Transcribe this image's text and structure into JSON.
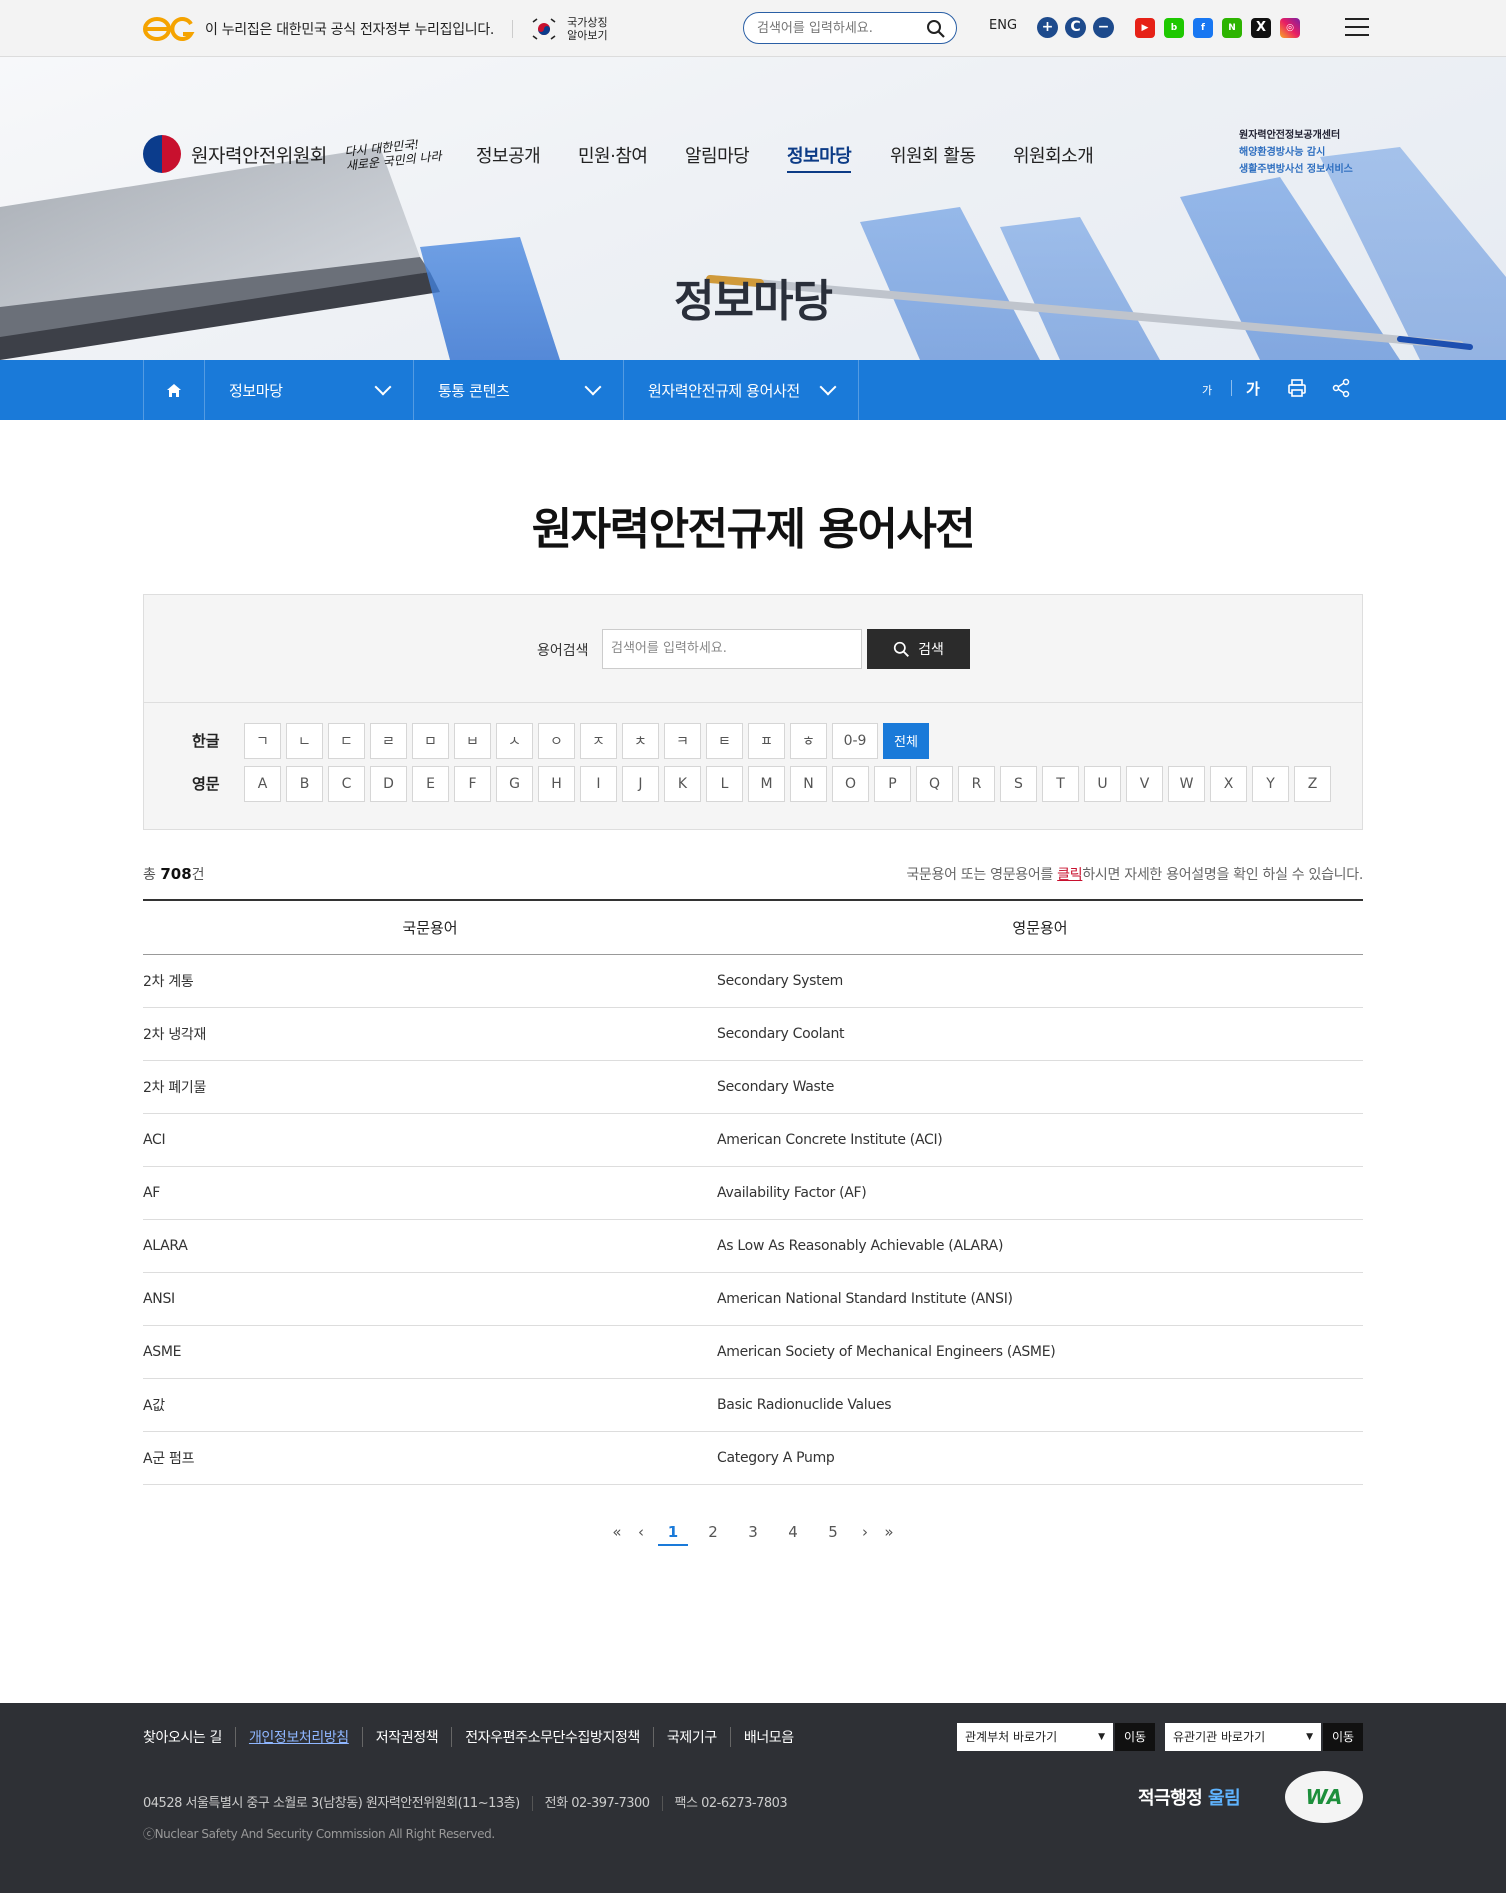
{
  "topbar": {
    "gov_text": "이 누리집은 대한민국 공식 전자정부 누리집입니다.",
    "symbol_line1": "국가상징",
    "symbol_line2": "알아보기",
    "search_placeholder": "검색어를 입력하세요.",
    "eng": "ENG",
    "zoom_in": "+",
    "zoom_reset": "C",
    "zoom_out": "−",
    "sns": [
      "youtube-icon",
      "blog-icon",
      "facebook-icon",
      "naver-icon",
      "x-icon",
      "instagram-icon"
    ]
  },
  "header": {
    "logo_text": "원자력안전위원회",
    "slogan_line1": "다시 대한민국!",
    "slogan_line2": "새로운 국민의 나라",
    "nav": [
      "정보공개",
      "민원·참여",
      "알림마당",
      "정보마당",
      "위원회 활동",
      "위원회소개"
    ],
    "side_links": [
      "원자력안전정보공개센터",
      "해양환경방사능 감시",
      "생활주변방사선 정보서비스"
    ]
  },
  "hero": {
    "title": "정보마당"
  },
  "location": {
    "items": [
      "정보마당",
      "통통 콘텐츠",
      "원자력안전규제 용어사전"
    ],
    "font_small": "가",
    "font_large": "가"
  },
  "main": {
    "title": "원자력안전규제 용어사전",
    "search_label": "용어검색",
    "search_placeholder": "검색어를 입력하세요.",
    "search_button": "검색",
    "korean_label": "한글",
    "korean_letters": [
      "ㄱ",
      "ㄴ",
      "ㄷ",
      "ㄹ",
      "ㅁ",
      "ㅂ",
      "ㅅ",
      "ㅇ",
      "ㅈ",
      "ㅊ",
      "ㅋ",
      "ㅌ",
      "ㅍ",
      "ㅎ",
      "0-9",
      "전체"
    ],
    "english_label": "영문",
    "english_letters": [
      "A",
      "B",
      "C",
      "D",
      "E",
      "F",
      "G",
      "H",
      "I",
      "J",
      "K",
      "L",
      "M",
      "N",
      "O",
      "P",
      "Q",
      "R",
      "S",
      "T",
      "U",
      "V",
      "W",
      "X",
      "Y",
      "Z"
    ],
    "total_prefix": "총",
    "total_count": "708",
    "total_suffix": "건",
    "notice_before": "국문용어 또는 영문용어를 ",
    "notice_click": "클릭",
    "notice_after": "하시면 자세한 용어설명을 확인 하실 수 있습니다.",
    "col_korean": "국문용어",
    "col_english": "영문용어",
    "rows": [
      {
        "ko": "2차 계통",
        "en": "Secondary System"
      },
      {
        "ko": "2차 냉각재",
        "en": "Secondary Coolant"
      },
      {
        "ko": "2차 폐기물",
        "en": "Secondary Waste"
      },
      {
        "ko": "ACI",
        "en": "American Concrete Institute (ACI)"
      },
      {
        "ko": "AF",
        "en": "Availability Factor (AF)"
      },
      {
        "ko": "ALARA",
        "en": "As Low As Reasonably Achievable (ALARA)"
      },
      {
        "ko": "ANSI",
        "en": "American National Standard Institute (ANSI)"
      },
      {
        "ko": "ASME",
        "en": "American Society of Mechanical Engineers (ASME)"
      },
      {
        "ko": "A값",
        "en": "Basic Radionuclide Values"
      },
      {
        "ko": "A군 펌프",
        "en": "Category A Pump"
      }
    ],
    "pages": [
      "1",
      "2",
      "3",
      "4",
      "5"
    ]
  },
  "footer": {
    "links": [
      "찾아오시는 길",
      "개인정보처리방침",
      "저작권정책",
      "전자우편주소무단수집방지정책",
      "국제기구",
      "배너모음"
    ],
    "select1": "관계부처 바로가기",
    "select2": "유관기관 바로가기",
    "go": "이동",
    "address": "04528 서울특별시 중구 소월로 3(남창동) 원자력안전위원회(11~13층)",
    "phone": "전화 02-397-7300",
    "fax": "팩스 02-6273-7803",
    "copyright": "ⓒNuclear Safety And Security Commission All Right Reserved.",
    "badge_a": "적극행정",
    "badge_b": "울림",
    "wa": "WA"
  },
  "colors": {
    "primary": "#1a7ad9",
    "navy": "#0c3b86",
    "footer": "#2e3035",
    "accent_red": "#c8102e"
  }
}
